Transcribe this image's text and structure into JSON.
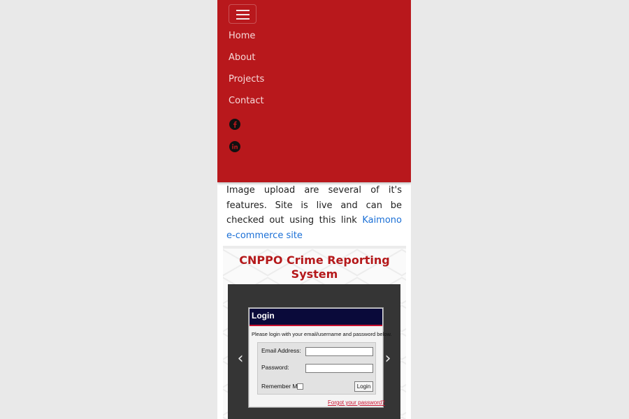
{
  "nav": {
    "links": [
      {
        "label": "Home"
      },
      {
        "label": "About"
      },
      {
        "label": "Projects"
      },
      {
        "label": "Contact"
      }
    ],
    "social_icons": [
      "facebook-icon",
      "linkedin-icon"
    ],
    "toggler_icon": "menu-icon"
  },
  "intro": {
    "text": "Image upload are several of it's features. Site is live and can be checked out using this link ",
    "link_text": "Kaimono e-commerce site"
  },
  "project": {
    "title": "CNPPO Crime Reporting System",
    "carousel_prev_icon": "chevron-left-icon",
    "carousel_next_icon": "chevron-right-icon",
    "screenshot": {
      "header": "Login",
      "intro": "Please login with your email/username and password below.",
      "email_label": "Email Address:",
      "password_label": "Password:",
      "remember_label": "Remember Me:",
      "login_button": "Login",
      "forgot_link": "Forgot your password?"
    }
  },
  "colors": {
    "navbar": "#b8181c",
    "title": "#b5191b",
    "link": "#1a6fd6",
    "carousel": "#353535"
  }
}
